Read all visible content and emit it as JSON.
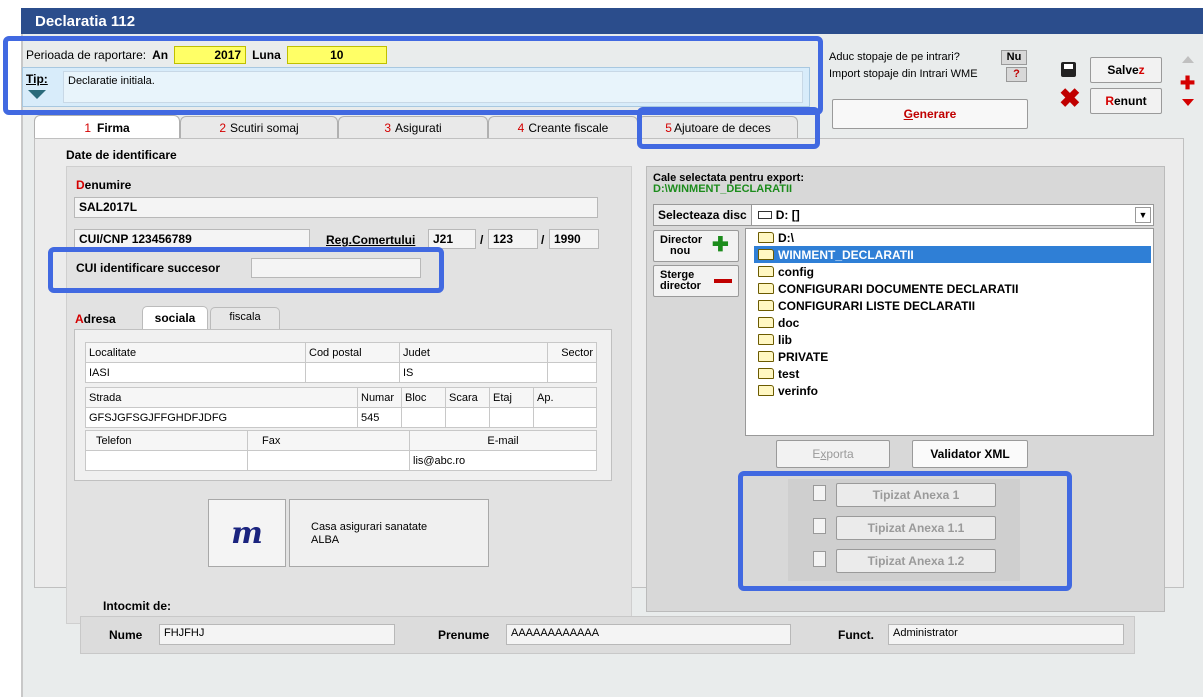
{
  "window": {
    "title": "Declaratia 112"
  },
  "period": {
    "label": "Perioada de raportare:",
    "an_label": "An",
    "an_value": "2017",
    "luna_label": "Luna",
    "luna_value": "10"
  },
  "tip": {
    "label": "Tip:",
    "value": "Declaratie initiala."
  },
  "options": {
    "stopaje_label": "Aduc stopaje de pe intrari?",
    "stopaje_value": "Nu",
    "import_label": "Import stopaje din Intrari WME",
    "import_value": "?"
  },
  "actions": {
    "generate_first": "G",
    "generate_rest": "enerare",
    "save_main": "Salve",
    "save_hot": "z",
    "cancel_hot": "R",
    "cancel_main": "enunt"
  },
  "tabs": [
    {
      "num": "1",
      "label": "Firma"
    },
    {
      "num": "2",
      "label": "Scutiri somaj"
    },
    {
      "num": "3",
      "label": "Asigurati"
    },
    {
      "num": "4",
      "label": "Creante fiscale"
    },
    {
      "num": "5",
      "label": "Ajutoare de deces"
    }
  ],
  "identification": {
    "section_title": "Date de identificare",
    "denumire_first": "D",
    "denumire_rest": "enumire",
    "denumire_value": "SAL2017L",
    "cui_label": "CUI/CNP",
    "cui_value": "123456789",
    "reg_label": "Reg.Comertului",
    "reg_part1": "J21",
    "sep1": "/",
    "reg_part2": "123",
    "sep2": "/",
    "reg_part3": "1990",
    "successor_label": "CUI identificare succesor",
    "successor_value": ""
  },
  "address": {
    "tab_adresa_first": "A",
    "tab_adresa_rest": "dresa",
    "tab_sociala": "sociala",
    "tab_fiscala": "fiscala",
    "headers1": [
      "Localitate",
      "Cod postal",
      "Judet",
      "Sector"
    ],
    "values1": [
      "IASI",
      "",
      "IS",
      ""
    ],
    "headers2": [
      "Strada",
      "Numar",
      "Bloc",
      "Scara",
      "Etaj",
      "Ap."
    ],
    "values2": [
      "GFSJGFSGJFFGHDFJDFG",
      "545",
      "",
      "",
      "",
      ""
    ],
    "headers3": [
      "Telefon",
      "Fax",
      "E-mail"
    ],
    "values3": [
      "",
      "",
      "lis@abc.ro"
    ]
  },
  "health": {
    "line1": "Casa asigurari sanatate",
    "line2": "ALBA",
    "logo": "m-logo"
  },
  "export": {
    "path_label": "Cale selectata pentru export:",
    "path_value": "D:\\WINMENT_DECLARATII",
    "disk_label_first": "Selecteaza disc",
    "disk_value": "D: []",
    "new_dir_line1": "Director",
    "new_dir_line2": "nou",
    "del_dir_line1": "Sterge",
    "del_dir_line2": "director",
    "tree_root": "D:\\",
    "tree_selected": "WINMENT_DECLARATII",
    "tree_items": [
      "config",
      "CONFIGURARI DOCUMENTE DECLARATII",
      "CONFIGURARI LISTE DECLARATII",
      "doc",
      "lib",
      "PRIVATE",
      "test",
      "verinfo"
    ],
    "export_btn_pre": "E",
    "export_btn_hot": "x",
    "export_btn_post": "porta",
    "validator_btn": "Validator XML",
    "anexe": [
      "Tipizat Anexa 1",
      "Tipizat Anexa 1.1",
      "Tipizat Anexa 1.2"
    ]
  },
  "prepared": {
    "title": "Intocmit de:",
    "nume_label": "Nume",
    "nume_value": "FHJFHJ",
    "prenume_label": "Prenume",
    "prenume_value": "AAAAAAAAAAAA",
    "funct_label": "Funct.",
    "funct_value": "Administrator"
  },
  "colors": {
    "titlebar": "#2b4d8c",
    "yellow_field": "#ffff66",
    "highlight": "#4169e1",
    "green_path": "#1c8c1c"
  }
}
